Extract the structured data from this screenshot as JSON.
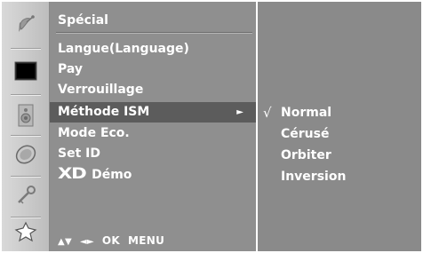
{
  "menu": {
    "title": "Spécial",
    "items": [
      {
        "label": "Langue(Language)"
      },
      {
        "label": "Pay"
      },
      {
        "label": "Verrouillage"
      },
      {
        "label": "Méthode ISM",
        "arrow": "►"
      },
      {
        "label": "Mode Eco."
      },
      {
        "label": "Set ID"
      },
      {
        "logo": "XD",
        "label": "Démo"
      }
    ],
    "selected_index": 3
  },
  "nav_hint": {
    "updown": "▲▼",
    "leftright": "◄►",
    "ok": "OK",
    "menu": "MENU"
  },
  "submenu": {
    "check_mark": "√",
    "items": [
      {
        "label": "Normal",
        "checked": true
      },
      {
        "label": "Cérusé",
        "checked": false
      },
      {
        "label": "Orbiter",
        "checked": false
      },
      {
        "label": "Inversion",
        "checked": false
      }
    ]
  },
  "sidebar_icons": [
    "satellite-dish-icon",
    "screen-icon",
    "speaker-icon",
    "clock-icon",
    "key-icon",
    "special-settings-icon"
  ],
  "colors": {
    "menu_bg": "#8f8f8f",
    "selected_bg": "#5c5c5c",
    "submenu_bg": "#8a8a8a",
    "icon_col_bg": "#cfcfcf",
    "text": "#ffffff"
  }
}
